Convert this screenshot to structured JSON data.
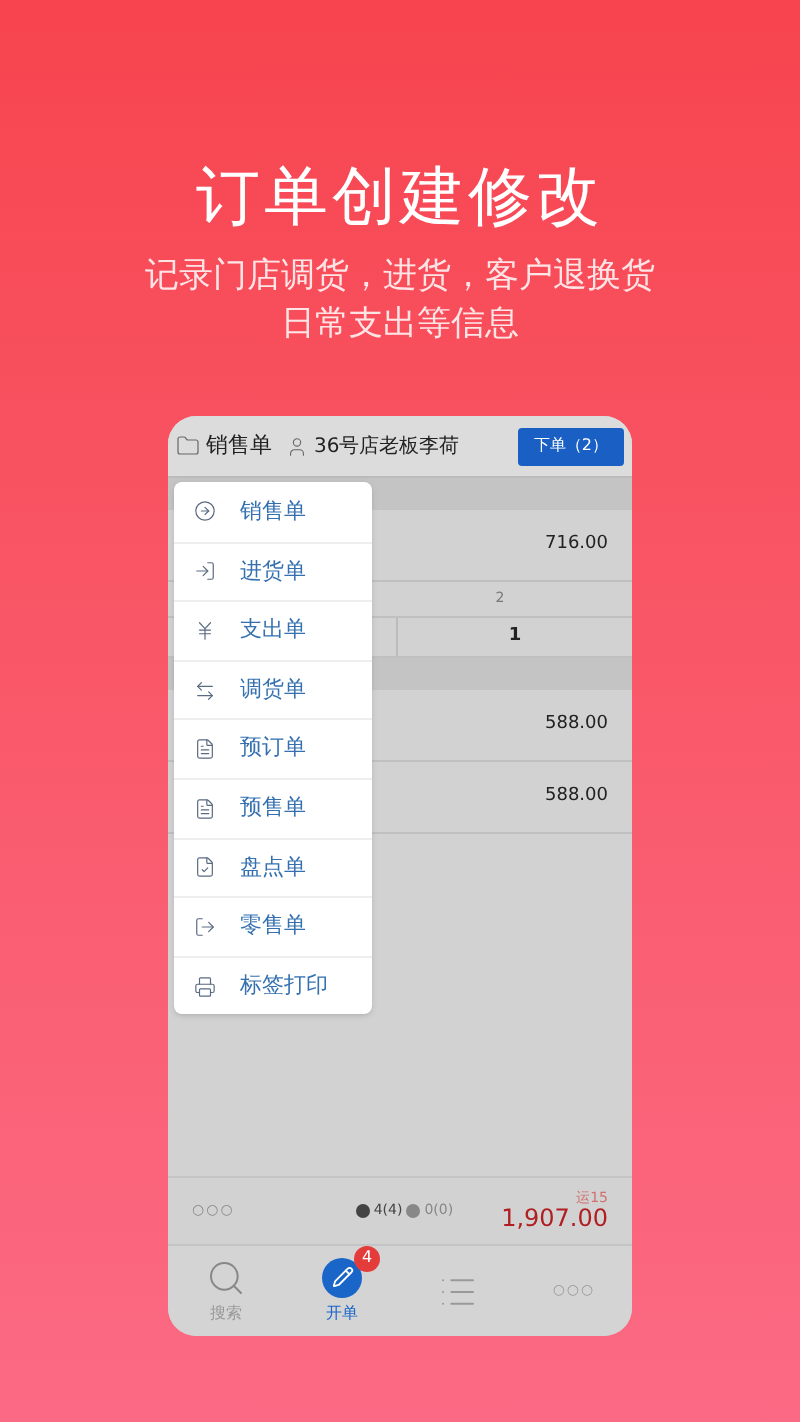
{
  "headline": "订单创建修改",
  "subtitle_lines": [
    "记录门店调货，进货，客户退换货",
    "日常支出等信息"
  ],
  "header": {
    "order_type": "销售单",
    "customer": "36号店老板李荷",
    "submit_button": "下单（2）"
  },
  "rows": [
    {
      "kind": "section"
    },
    {
      "kind": "amount",
      "value": "716.00"
    },
    {
      "kind": "small",
      "value": "2"
    },
    {
      "kind": "split",
      "value": "1"
    },
    {
      "kind": "section"
    },
    {
      "kind": "amount",
      "value": "588.00"
    },
    {
      "kind": "amount",
      "value": "588.00"
    }
  ],
  "menu": [
    {
      "label": "销售单",
      "kind": "out"
    },
    {
      "label": "进货单",
      "kind": "in"
    },
    {
      "label": "支出单",
      "kind": "yen"
    },
    {
      "label": "调货单",
      "kind": "swap"
    },
    {
      "label": "预订单",
      "kind": "doc"
    },
    {
      "label": "预售单",
      "kind": "doc"
    },
    {
      "label": "盘点单",
      "kind": "check"
    },
    {
      "label": "零售单",
      "kind": "share"
    },
    {
      "label": "标签打印",
      "kind": "print"
    }
  ],
  "footer": {
    "more": "○○○",
    "count_a": "4(4)",
    "count_b": "0(0)",
    "freight": "运15",
    "total": "1,907.00"
  },
  "tabs": [
    {
      "kind": "search",
      "label": "搜索",
      "selected": false
    },
    {
      "kind": "pen",
      "label": "开单",
      "badge": "4",
      "selected": true
    },
    {
      "kind": "list",
      "selected": false
    },
    {
      "kind": "more",
      "glyph": "○○○",
      "selected": false
    }
  ]
}
